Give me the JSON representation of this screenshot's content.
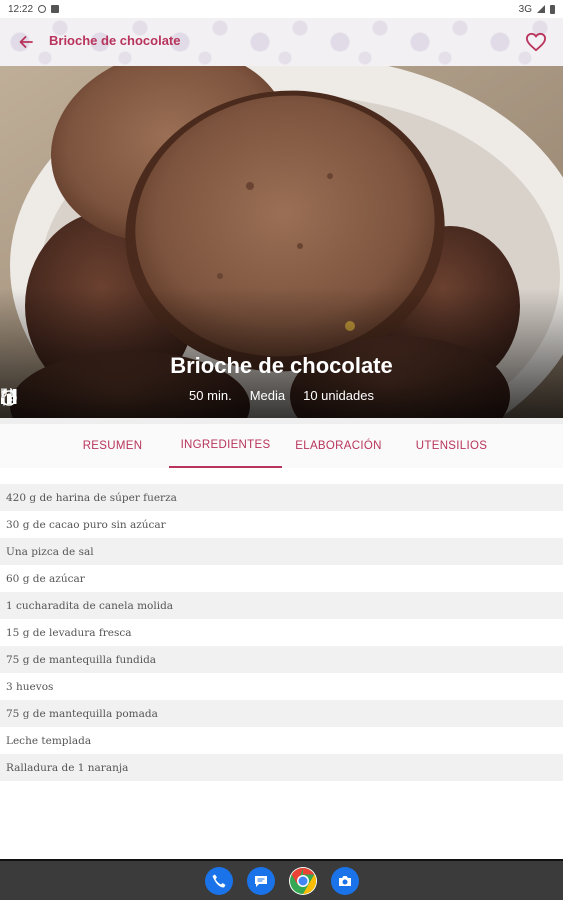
{
  "status_bar": {
    "time": "12:22",
    "network": "3G"
  },
  "app_bar": {
    "title": "Brioche de chocolate",
    "accent_color": "#b8345c"
  },
  "hero": {
    "title": "Brioche de chocolate",
    "time": "50 min.",
    "difficulty": "Media",
    "servings": "10 unidades"
  },
  "tabs": [
    {
      "label": "RESUMEN"
    },
    {
      "label": "INGREDIENTES"
    },
    {
      "label": "ELABORACIÓN"
    },
    {
      "label": "UTENSILIOS"
    }
  ],
  "active_tab": "INGREDIENTES",
  "ingredients": [
    "420 g de harina de súper fuerza",
    "30 g de cacao puro sin azúcar",
    "Una pizca de sal",
    "60 g de azúcar",
    "1 cucharadita de canela molida",
    "15 g de levadura fresca",
    "75 g de mantequilla fundida",
    "3 huevos",
    "75 g de mantequilla pomada",
    "Leche templada",
    "Ralladura de 1 naranja"
  ],
  "dock": [
    {
      "icon": "phone-icon",
      "color": "#1a73e8"
    },
    {
      "icon": "messages-icon",
      "color": "#1a73e8"
    },
    {
      "icon": "chrome-icon",
      "color": "#ea4335"
    },
    {
      "icon": "camera-icon",
      "color": "#1a73e8"
    }
  ]
}
